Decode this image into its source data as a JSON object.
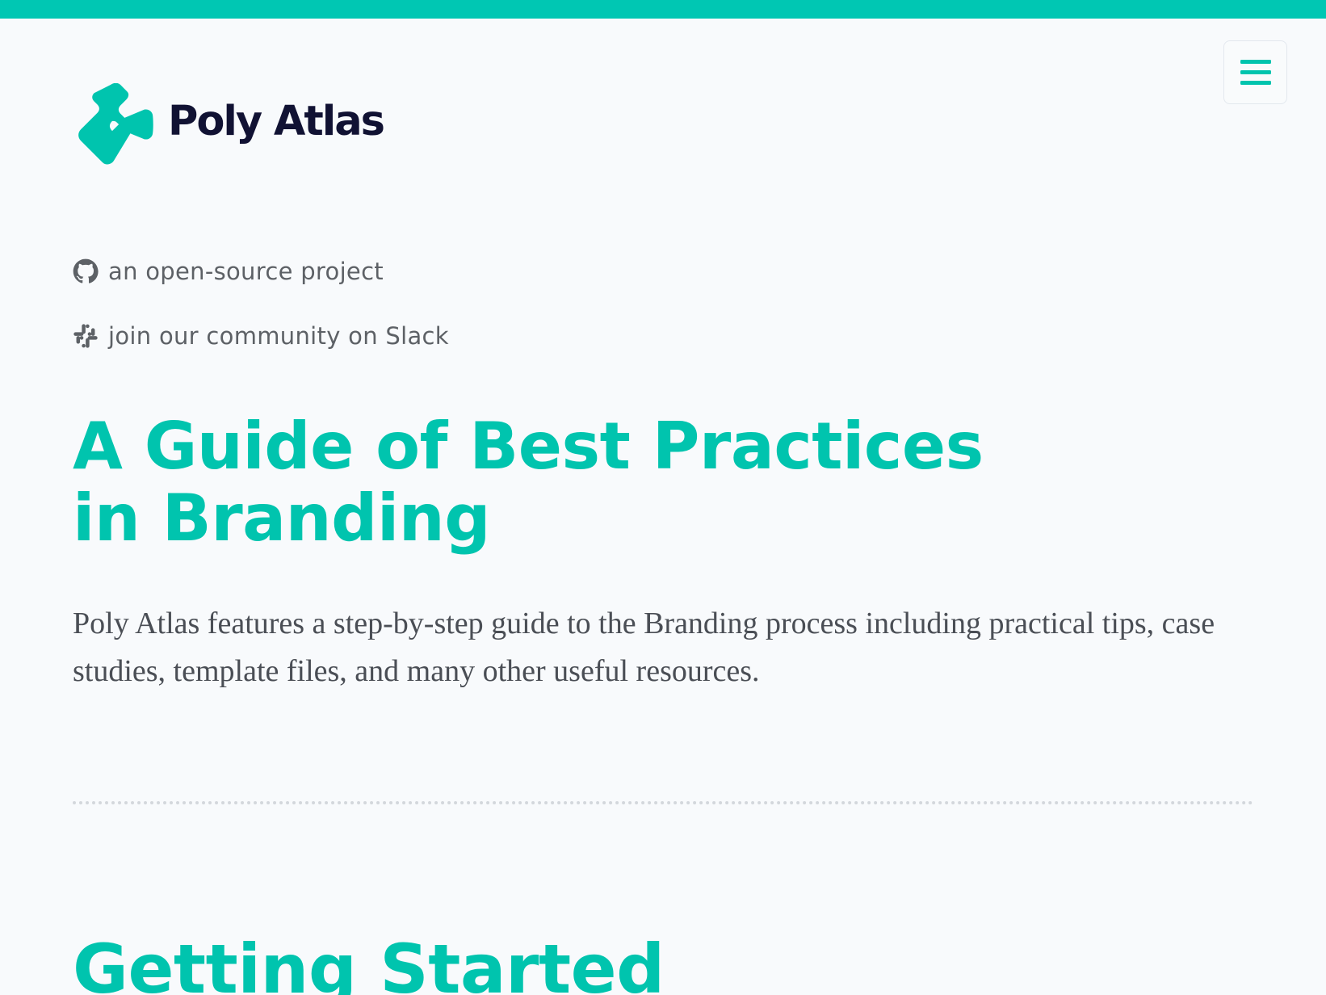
{
  "colors": {
    "accent": "#00c4ae",
    "top_bar": "#00c7b3",
    "brand_text": "#111233",
    "muted_text": "#5d6166",
    "body_text": "#4a4e55",
    "background": "#f8fafc"
  },
  "header": {
    "brand_name": "Poly Atlas",
    "logo_icon": "poly-atlas-logo-icon",
    "menu_icon": "hamburger-icon"
  },
  "links": [
    {
      "icon": "github-icon",
      "label": "an open-source project"
    },
    {
      "icon": "slack-icon",
      "label": "join our community on Slack"
    }
  ],
  "hero": {
    "title_lines": [
      "A Guide of Best Practices",
      "in Branding"
    ],
    "description": "Poly Atlas features a step-by-step guide to the Branding process including practical tips, case studies, template files, and many other useful resources."
  },
  "sections": [
    {
      "title": "Getting Started"
    }
  ]
}
